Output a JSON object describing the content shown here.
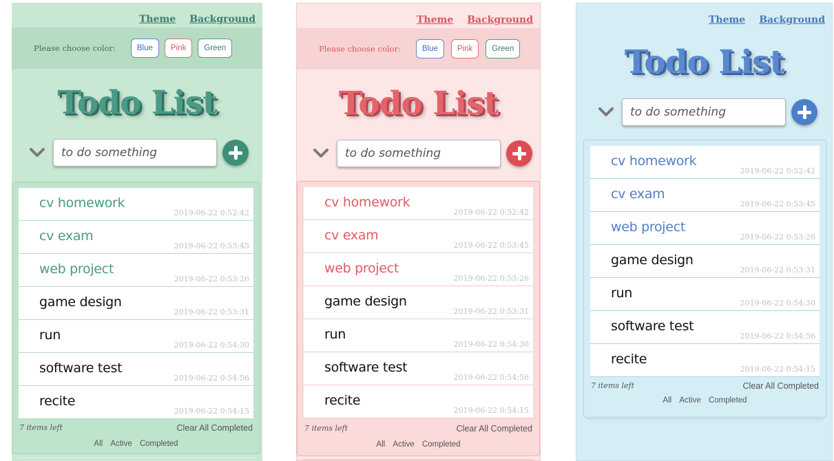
{
  "nav": {
    "theme_label": "Theme",
    "background_label": "Background"
  },
  "color_chooser": {
    "label": "Please choose color:",
    "blue": "Blue",
    "pink": "Pink",
    "green": "Green"
  },
  "app_title": "Todo List",
  "input": {
    "placeholder": "to do something"
  },
  "todos": [
    {
      "text": "cv homework",
      "time": "2019-06-22 0:52:42"
    },
    {
      "text": "cv exam",
      "time": "2019-06-22 0:53:45"
    },
    {
      "text": "web project",
      "time": "2019-06-22 0:53:26"
    },
    {
      "text": "game design",
      "time": "2019-06-22 0:53:31"
    },
    {
      "text": "run",
      "time": "2019-06-22 0:54:30"
    },
    {
      "text": "software test",
      "time": "2019-06-22 0:54:56"
    },
    {
      "text": "recite",
      "time": "2019-06-22 0:54:15"
    }
  ],
  "footer": {
    "items_left": "7 items left",
    "clear_completed": "Clear All Completed"
  },
  "filters": {
    "all": "All",
    "active": "Active",
    "completed": "Completed"
  },
  "themes": {
    "green": {
      "accent": "#4a9a86",
      "background": "#c8e8d3"
    },
    "pink": {
      "accent": "#e6636b",
      "background": "#fde6e6"
    },
    "blue": {
      "accent": "#5a89cf",
      "background": "#d5eef5"
    }
  },
  "icons": {
    "toggle_all": "chevron-down-icon",
    "add": "plus-circle-icon"
  }
}
